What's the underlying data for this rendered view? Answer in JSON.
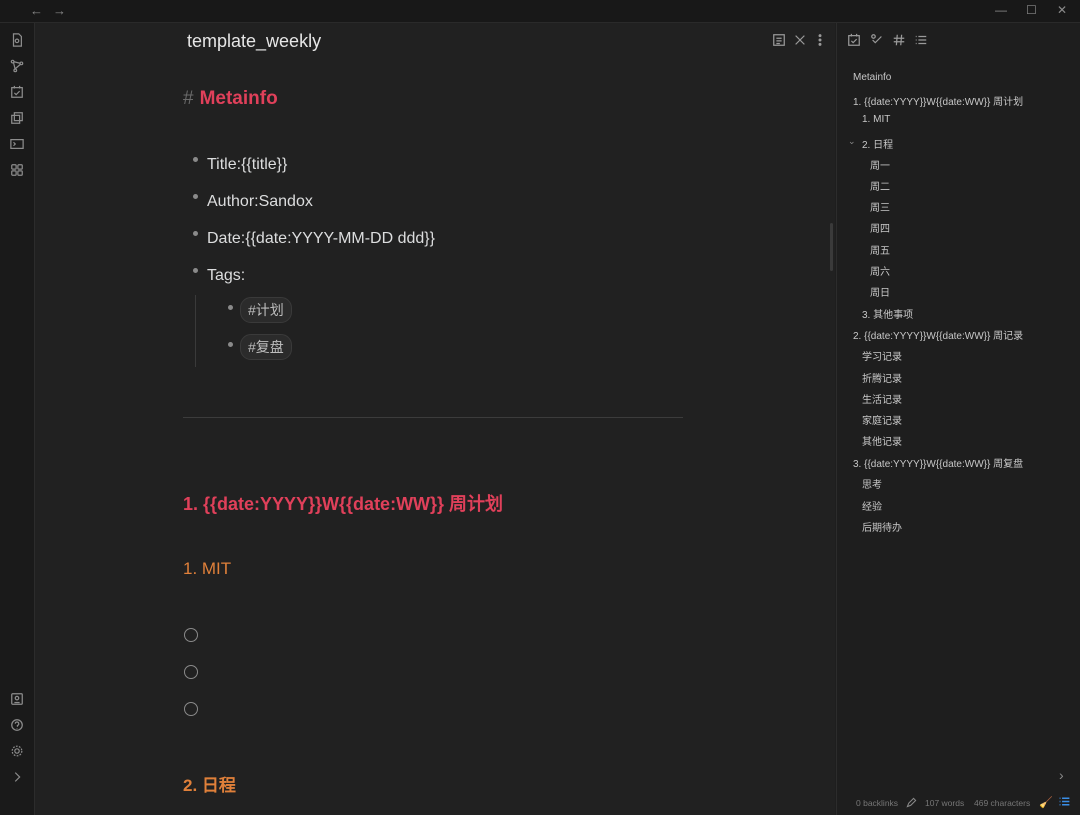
{
  "titlebar": {
    "back": "←",
    "forward": "→",
    "minimize": "—",
    "maximize": "☐",
    "close": "✕"
  },
  "ribbon": {
    "top_icons": [
      "file-icon",
      "graph-icon",
      "calendar-check-icon",
      "copy-icon",
      "terminal-icon",
      "grid-icon"
    ],
    "bottom_icons": [
      "vault-icon",
      "help-icon",
      "settings-icon",
      "expand-icon"
    ]
  },
  "note": {
    "title": "template_weekly",
    "actions": [
      "reading-view-icon",
      "close-icon",
      "more-icon"
    ],
    "h1_hash": "#",
    "h1": "Metainfo",
    "bullets": [
      "Title:{{title}}",
      "Author:Sandox",
      "Date:{{date:YYYY-MM-DD ddd}}",
      "Tags:"
    ],
    "tags": [
      "#计划",
      "#复盘"
    ],
    "h2_plan": "1. {{date:YYYY}}W{{date:WW}} 周计划",
    "h3_mit": "1. MIT",
    "h3_schedule": "2. 日程"
  },
  "right_pane": {
    "tabs": [
      "tasks-icon",
      "tags-link-icon",
      "hash-icon",
      "list-icon"
    ],
    "outline": [
      "Metainfo",
      "1. {{date:YYYY}}W{{date:WW}} 周计划",
      "1. MIT",
      "2. 日程",
      "周一",
      "周二",
      "周三",
      "周四",
      "周五",
      "周六",
      "周日",
      "3. 其他事项",
      "2. {{date:YYYY}}W{{date:WW}} 周记录",
      "学习记录",
      "折腾记录",
      "生活记录",
      "家庭记录",
      "其他记录",
      "3. {{date:YYYY}}W{{date:WW}} 周复盘",
      "思考",
      "经验",
      "后期待办"
    ],
    "collapse_arrow": "›"
  },
  "status": {
    "backlinks": "0 backlinks",
    "words": "107 words",
    "characters": "469 characters"
  },
  "colors": {
    "h1": "#e0405a",
    "h3": "#e0803a",
    "accent": "#3a8ee6"
  }
}
